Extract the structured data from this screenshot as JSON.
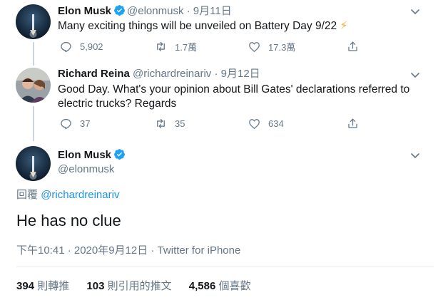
{
  "tweet1": {
    "name": "Elon Musk",
    "handle": "@elonmusk",
    "separator": "·",
    "date": "9月11日",
    "text": "Many exciting things will be unveiled on Battery Day 9/22",
    "emoji": "⚡",
    "replies": "5,902",
    "retweets": "1.7萬",
    "likes": "17.3萬"
  },
  "tweet2": {
    "name": "Richard Reina",
    "handle": "@richardreinariv",
    "separator": "·",
    "date": "9月12日",
    "text": "Good Day. What's your opinion about Bill Gates' declarations referred to electric trucks? Regards",
    "replies": "37",
    "retweets": "35",
    "likes": "634"
  },
  "main_tweet": {
    "name": "Elon Musk",
    "handle": "@elonmusk",
    "reply_prefix": "回覆",
    "reply_to": "@richardreinariv",
    "text": "He has no clue",
    "timestamp": "下午10:41 · 2020年9月12日 · Twitter for iPhone",
    "stats": [
      {
        "count": "394",
        "label": "則轉推"
      },
      {
        "count": "103",
        "label": "則引用的推文"
      },
      {
        "count": "4,586",
        "label": "個喜歡"
      }
    ]
  },
  "colors": {
    "accent": "#1da1f2",
    "link": "#1b95e0",
    "muted": "#657786",
    "lightning": "#ffac33"
  },
  "icons": [
    "verified-badge-icon",
    "chevron-down-icon",
    "reply-icon",
    "retweet-icon",
    "like-icon",
    "share-icon"
  ]
}
